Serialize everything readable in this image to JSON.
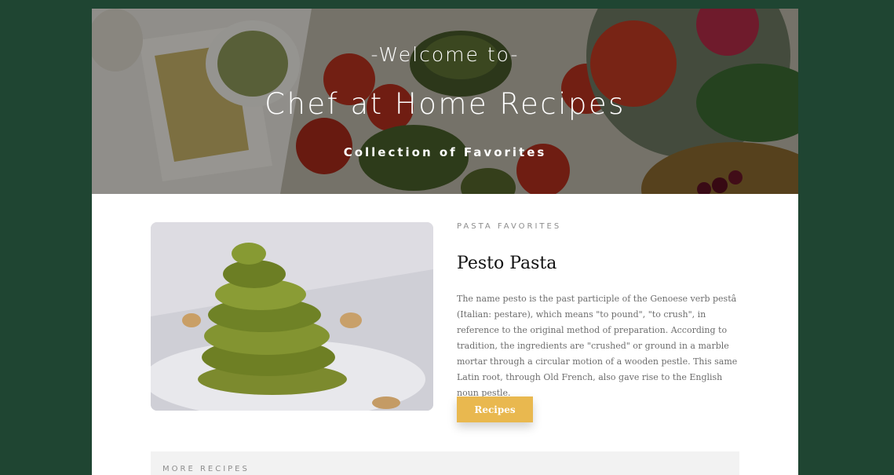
{
  "hero": {
    "pretitle": "-Welcome to-",
    "title": "Chef at Home Recipes",
    "subtitle": "Collection of Favorites"
  },
  "feature": {
    "eyebrow": "PASTA FAVORITES",
    "title": "Pesto Pasta",
    "description": "The name pesto is the past participle of the Genoese verb pestâ (Italian: pestare), which means \"to pound\", \"to crush\", in reference to the original method of preparation. According to tradition, the ingredients are \"crushed\" or ground in a marble mortar through a circular motion of a wooden pestle. This same Latin root, through Old French, also gave rise to the English noun pestle.",
    "button_label": "Recipes"
  },
  "more": {
    "label": "MORE RECIPES"
  },
  "colors": {
    "page_bg": "#1f4532",
    "accent": "#e9b84f"
  }
}
